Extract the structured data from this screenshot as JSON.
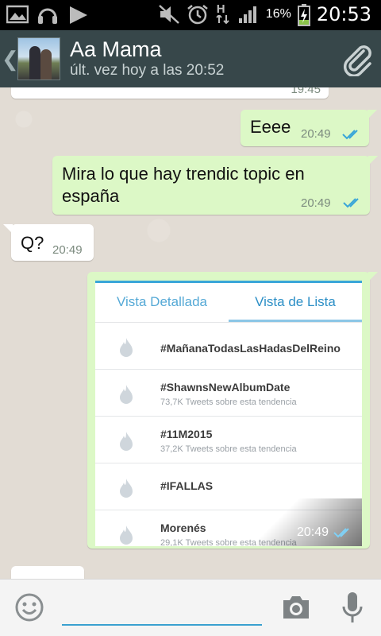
{
  "status_bar": {
    "battery_percent": "16%",
    "time": "20:53",
    "network_label": "H",
    "icons": [
      "gallery-icon",
      "headset-icon",
      "play-icon",
      "mute-icon",
      "alarm-icon",
      "hspa-icon",
      "signal-icon",
      "battery-charging-icon"
    ]
  },
  "header": {
    "contact_name": "Aa Mama",
    "last_seen": "últ. vez hoy a las 20:52",
    "back_glyph": "❮"
  },
  "messages": [
    {
      "dir": "in",
      "text": "",
      "time": "19:45"
    },
    {
      "dir": "out",
      "text": "Eeee",
      "time": "20:49",
      "read": true
    },
    {
      "dir": "out",
      "text": "Mira lo que hay trendic topic en españa",
      "time": "20:49",
      "read": true
    },
    {
      "dir": "in",
      "text": "Q?",
      "time": "20:49"
    },
    {
      "dir": "out",
      "type": "image",
      "time": "20:49",
      "read": true
    }
  ],
  "trends_image": {
    "tabs": [
      "Vista Detallada",
      "Vista de Lista"
    ],
    "active_tab": 1,
    "rows": [
      {
        "tag": "#MañanaTodasLasHadasDelReino",
        "sub": ""
      },
      {
        "tag": "#ShawnsNewAlbumDate",
        "sub": "73,7K Tweets sobre esta tendencia"
      },
      {
        "tag": "#11M2015",
        "sub": "37,2K Tweets sobre esta tendencia"
      },
      {
        "tag": "#IFALLAS",
        "sub": ""
      },
      {
        "tag": "Morenés",
        "sub": "29,1K Tweets sobre esta tendencia"
      }
    ]
  },
  "input": {
    "placeholder": "",
    "value": ""
  },
  "colors": {
    "header_bg": "#37474a",
    "out_bubble": "#dcf8c6",
    "in_bubble": "#ffffff",
    "read_ticks": "#3aa6d8"
  }
}
